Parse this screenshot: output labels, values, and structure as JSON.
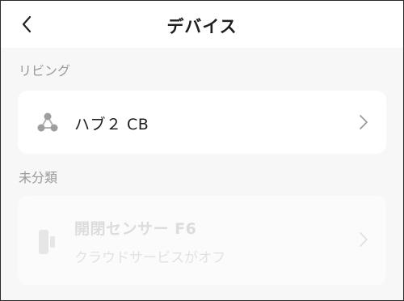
{
  "header": {
    "title": "デバイス",
    "back_icon": "chevron-left-icon"
  },
  "sections": [
    {
      "label": "リビング",
      "devices": [
        {
          "name": "ハブ２ CB",
          "icon": "hub-icon",
          "status": ""
        }
      ]
    },
    {
      "label": "未分類",
      "devices": [
        {
          "name": "開閉センサー F6",
          "icon": "contact-sensor-icon",
          "status": "クラウドサービスがオフ"
        }
      ]
    }
  ],
  "colors": {
    "background": "#f7f7f7",
    "card": "#ffffff",
    "section_label": "#9a9a9a",
    "disabled_text": "#dcdcdc"
  }
}
